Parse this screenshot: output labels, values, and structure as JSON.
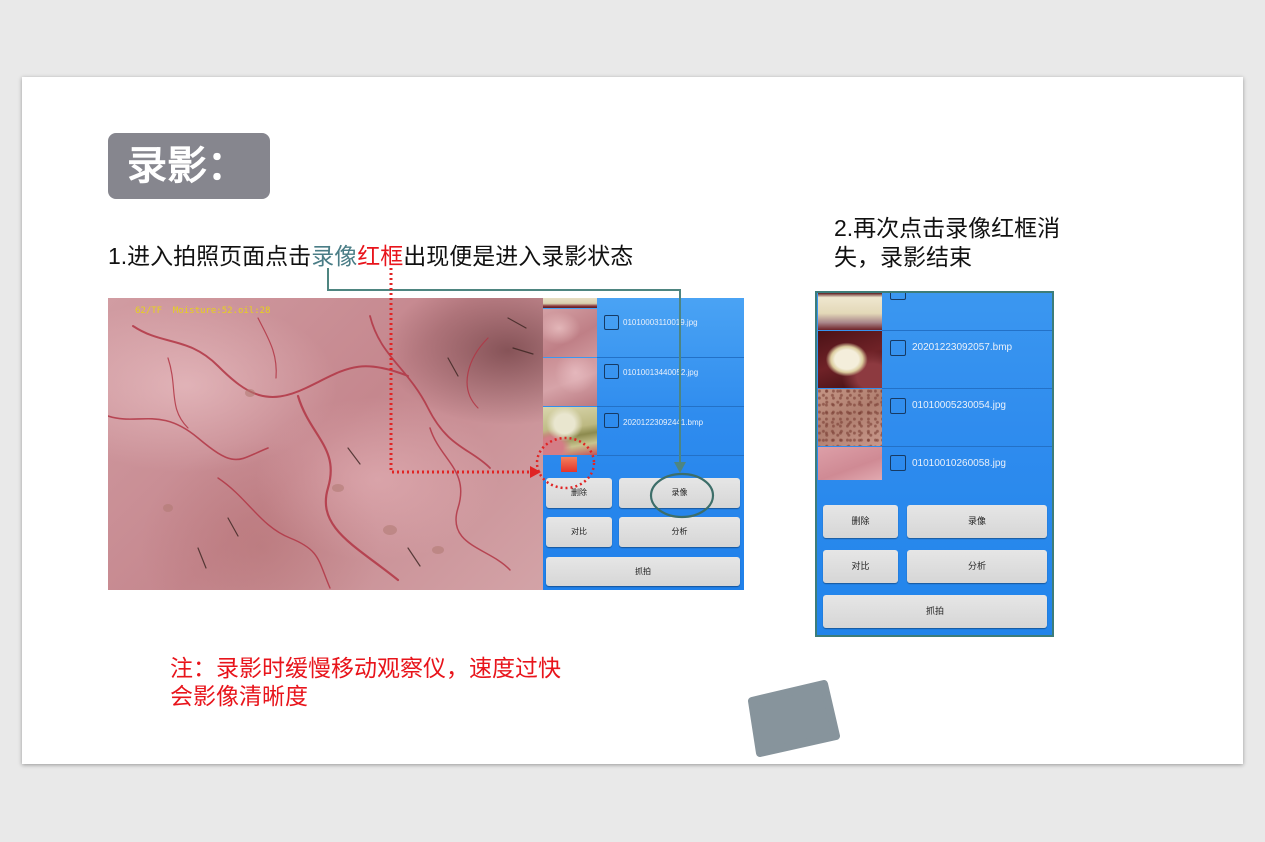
{
  "slide": {
    "title": "录影：",
    "step1": {
      "prefix": "1.进入拍照页面点击",
      "keyword_record": "录像",
      "keyword_frame": "红框",
      "suffix": "出现便是进入录影状态"
    },
    "step2": {
      "line1": "2.再次点击录像红框消",
      "line2": "失，录影结束"
    },
    "note": {
      "line1": "注：录影时缓慢移动观察仪，速度过快",
      "line2": "会影像清晰度"
    }
  },
  "recording_screen": {
    "overlay_readout": "62/TF  Moisture:52.oil:28",
    "files": [
      {
        "name": "01010003110019.jpg"
      },
      {
        "name": "01010013440052.jpg"
      },
      {
        "name": "20201223092441.bmp"
      }
    ],
    "recording_indicator": "red-square-icon",
    "buttons": {
      "delete": "删除",
      "record": "录像",
      "compare": "对比",
      "analyze": "分析",
      "capture": "抓拍"
    }
  },
  "stopped_screen": {
    "files": [
      {
        "name": "20201223092057.bmp"
      },
      {
        "name": "01010005230054.jpg"
      },
      {
        "name": "01010010260058.jpg"
      }
    ],
    "buttons": {
      "delete": "删除",
      "record": "录像",
      "compare": "对比",
      "analyze": "分析",
      "capture": "抓拍"
    }
  },
  "colors": {
    "badge": "#86868e",
    "kw-record": "#4a7d86",
    "kw-frame": "#e8141b",
    "note": "#e8141b",
    "panel": "#2f8cee",
    "teal": "#4e8580",
    "red": "#e02424"
  }
}
